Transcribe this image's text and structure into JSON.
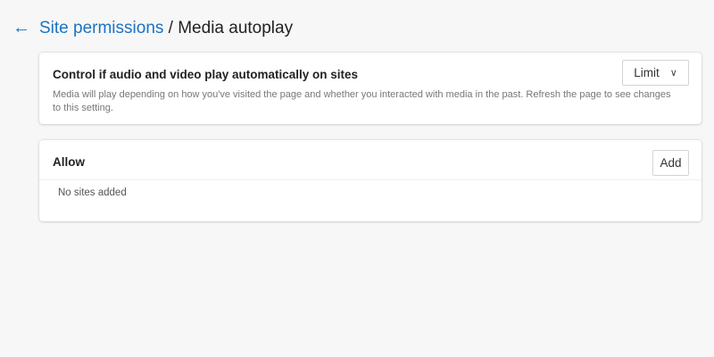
{
  "header": {
    "back_icon": "arrow-left-icon",
    "breadcrumb_link": "Site permissions",
    "separator": " / ",
    "page_title": "Media autoplay"
  },
  "autoplay": {
    "title": "Control if audio and video play automatically on sites",
    "description": "Media will play depending on how you've visited the page and whether you interacted with media in the past. Refresh the page to see changes to this setting.",
    "selected": "Limit"
  },
  "allow": {
    "title": "Allow",
    "add_label": "Add",
    "empty_text": "No sites added"
  }
}
